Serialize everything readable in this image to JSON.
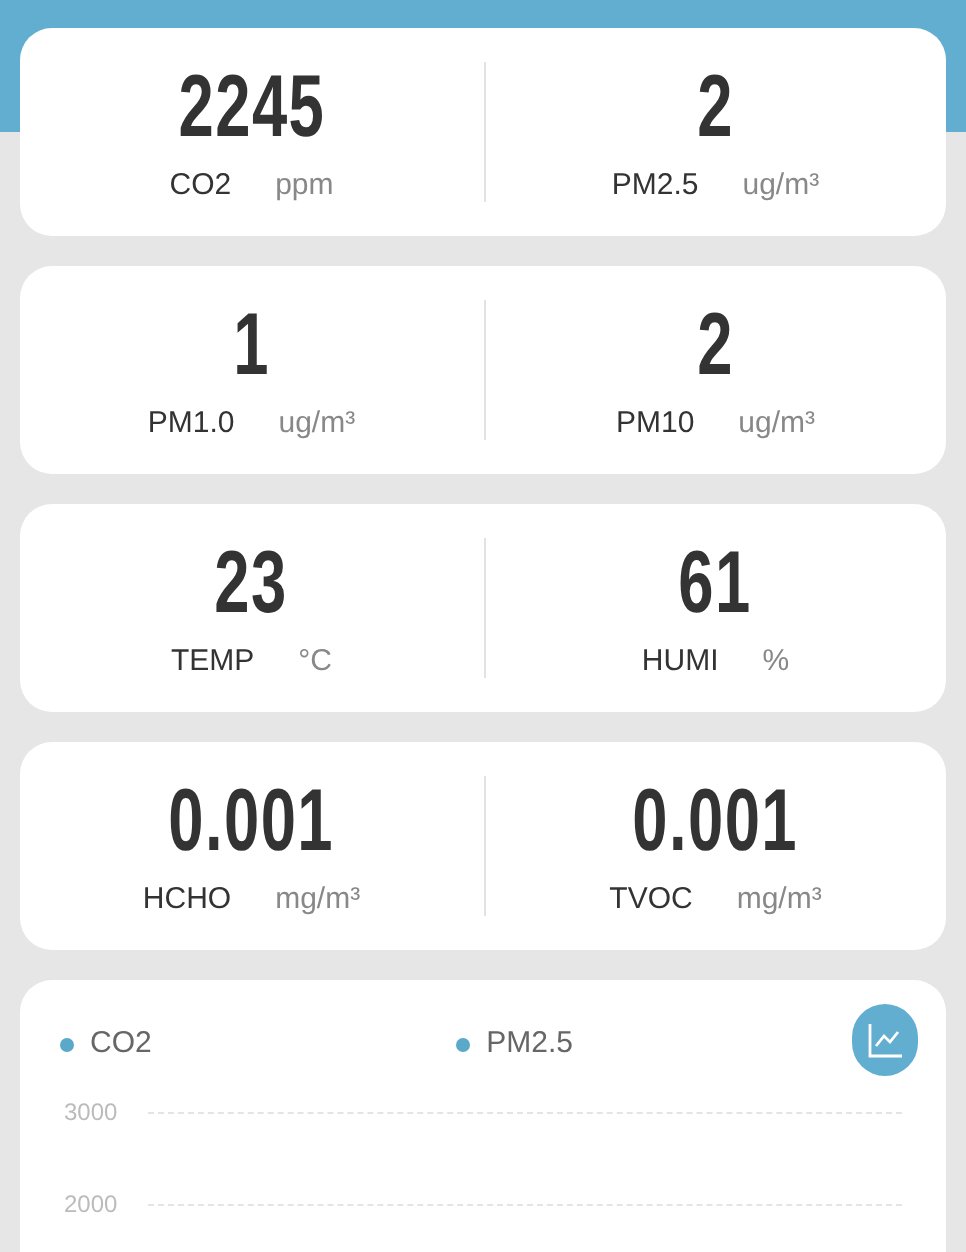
{
  "cards": [
    {
      "readings": [
        {
          "value": "2245",
          "label": "CO2",
          "unit": "ppm"
        },
        {
          "value": "2",
          "label": "PM2.5",
          "unit": "ug/m³"
        }
      ]
    },
    {
      "readings": [
        {
          "value": "1",
          "label": "PM1.0",
          "unit": "ug/m³"
        },
        {
          "value": "2",
          "label": "PM10",
          "unit": "ug/m³"
        }
      ]
    },
    {
      "readings": [
        {
          "value": "23",
          "label": "TEMP",
          "unit": "°C"
        },
        {
          "value": "61",
          "label": "HUMI",
          "unit": "%"
        }
      ]
    },
    {
      "readings": [
        {
          "value": "0.001",
          "label": "HCHO",
          "unit": "mg/m³"
        },
        {
          "value": "0.001",
          "label": "TVOC",
          "unit": "mg/m³"
        }
      ]
    }
  ],
  "trend": {
    "chart_data": {
      "type": "line",
      "series": [
        {
          "name": "CO2",
          "color": "#5aa9c9"
        },
        {
          "name": "PM2.5",
          "color": "#5aa9c9"
        }
      ],
      "yticks": [
        3000,
        2000
      ],
      "ylim": [
        2000,
        3000
      ]
    }
  }
}
